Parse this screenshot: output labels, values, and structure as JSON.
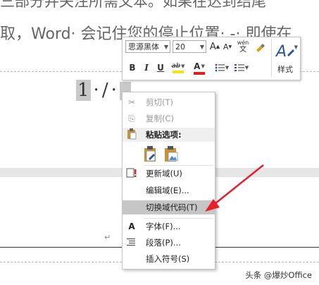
{
  "document": {
    "line1": "三部分并关注所需文本。如果在达到结尾",
    "line2": "取，Word· 会记住您的停止位置· -· 即使在",
    "field_num": "1",
    "field_sep1": "·",
    "field_slash": "/",
    "field_sep2": "·",
    "paragraph_mark": "↵"
  },
  "mini_toolbar": {
    "font_name": "思源黑体",
    "font_size": "20",
    "grow_font": "A",
    "shrink_font": "A",
    "phonetic_top": "wén",
    "phonetic_bottom": "文",
    "bold": "B",
    "italic": "I",
    "underline": "U",
    "highlight": "ab",
    "font_color": "A",
    "styles_label": "样式",
    "highlight_color": "#f5e21a",
    "font_color_bar": "#e02020",
    "styles_color": "#2b579a"
  },
  "context_menu": {
    "items": [
      {
        "label": "剪切(T)",
        "icon": "cut-icon",
        "glyph": "✂",
        "disabled": true
      },
      {
        "label": "复制(C)",
        "icon": "copy-icon",
        "glyph": "⎘",
        "disabled": true
      },
      {
        "label": "粘贴选项:",
        "icon": "paste-icon",
        "glyph": "📋"
      },
      {
        "label": "更新域(U)",
        "icon": "update-field-icon",
        "glyph": "!"
      },
      {
        "label": "编辑域(E)...",
        "icon": "",
        "glyph": ""
      },
      {
        "label": "切换域代码(T)",
        "icon": "",
        "glyph": "",
        "highlighted": true
      },
      {
        "label": "字体(F)...",
        "icon": "font-icon",
        "glyph": "A"
      },
      {
        "label": "段落(P)...",
        "icon": "paragraph-icon",
        "glyph": "≡"
      },
      {
        "label": "插入符号(S)",
        "icon": "",
        "glyph": ""
      }
    ],
    "highlight_color": "#c6c6c6"
  },
  "annotation": {
    "arrow_color": "#e5202a"
  },
  "watermark": "头条 @爆炒Office"
}
